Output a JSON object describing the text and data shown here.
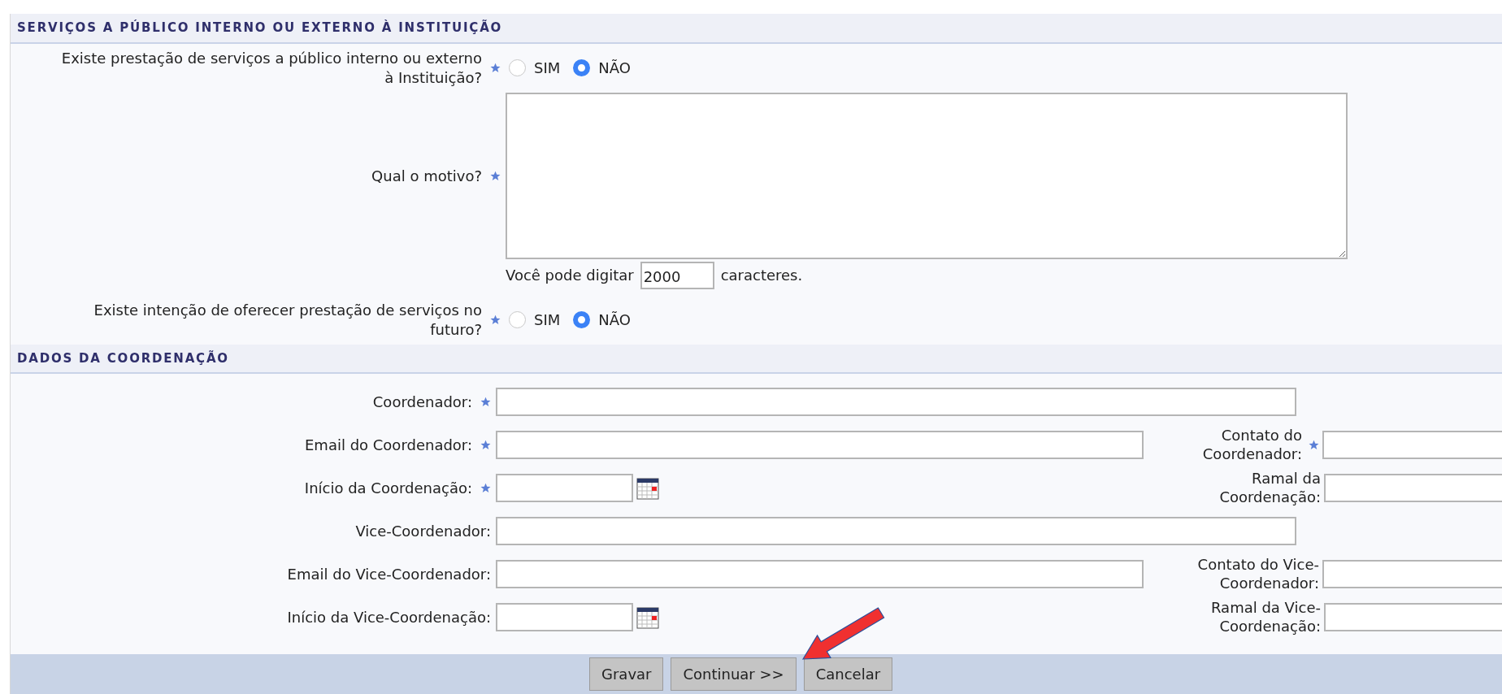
{
  "services": {
    "title": "SERVIÇOS A PÚBLICO INTERNO OU EXTERNO À INSTITUIÇÃO",
    "rows": [
      {
        "kind": "radio",
        "label": "Existe prestação de serviços a público interno ou externo à Instituição?",
        "required": true,
        "options": [
          {
            "label": "SIM",
            "selected": false
          },
          {
            "label": "NÃO",
            "selected": true
          }
        ]
      },
      {
        "kind": "textarea",
        "label": "Qual o motivo?",
        "required": true,
        "counter_prefix": "Você pode digitar",
        "counter_value": "2000",
        "counter_suffix": "caracteres."
      },
      {
        "kind": "radio",
        "label": "Existe intenção de oferecer prestação de serviços no futuro?",
        "required": true,
        "options": [
          {
            "label": "SIM",
            "selected": false
          },
          {
            "label": "NÃO",
            "selected": true
          }
        ]
      }
    ]
  },
  "coordination": {
    "title": "DADOS DA COORDENAÇÃO",
    "rows": [
      {
        "fields": [
          {
            "kind": "wide",
            "label": "Coordenador:",
            "required": true
          }
        ]
      },
      {
        "fields": [
          {
            "kind": "text",
            "label": "Email do Coordenador:",
            "required": true
          },
          {
            "kind": "text",
            "label": "Contato do Coordenador:",
            "required": true
          }
        ]
      },
      {
        "fields": [
          {
            "kind": "date",
            "label": "Início da Coordenação:",
            "required": true
          },
          {
            "kind": "text",
            "label": "Ramal da Coordenação:",
            "required": false
          }
        ]
      },
      {
        "fields": [
          {
            "kind": "wide",
            "label": "Vice-Coordenador:",
            "required": false
          }
        ]
      },
      {
        "fields": [
          {
            "kind": "text",
            "label": "Email do Vice-Coordenador:",
            "required": false
          },
          {
            "kind": "text",
            "label": "Contato do Vice-Coordenador:",
            "required": false
          }
        ]
      },
      {
        "fields": [
          {
            "kind": "date",
            "label": "Início da Vice-Coordenação:",
            "required": false
          },
          {
            "kind": "text",
            "label": "Ramal da Vice-Coordenação:",
            "required": false
          }
        ]
      }
    ]
  },
  "buttons": [
    "Gravar",
    "Continuar >>",
    "Cancelar"
  ]
}
